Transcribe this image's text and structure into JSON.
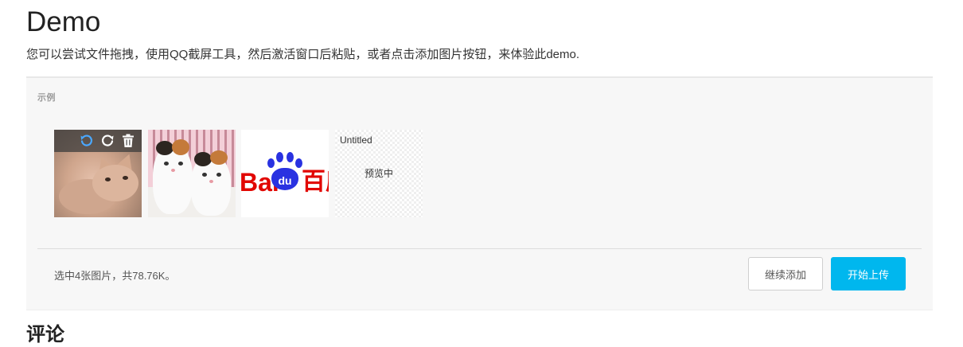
{
  "header": {
    "title": "Demo",
    "description": "您可以尝试文件拖拽，使用QQ截屏工具，然后激活窗口后粘贴，或者点击添加图片按钮，来体验此demo."
  },
  "panel": {
    "label": "示例",
    "thumbnails": [
      {
        "kind": "image",
        "subject": "kitten",
        "overlay_icons": [
          "rotate-left-icon",
          "rotate-right-icon",
          "trash-icon"
        ]
      },
      {
        "kind": "image",
        "subject": "two-kittens"
      },
      {
        "kind": "image",
        "subject": "baidu-logo",
        "logo_text_left": "Bai",
        "logo_text_paw": "du",
        "logo_text_right": "百度"
      },
      {
        "kind": "placeholder",
        "name": "Untitled",
        "status": "预览中"
      }
    ],
    "status_text": "选中4张图片，共78.76K。",
    "buttons": {
      "continue_label": "继续添加",
      "upload_label": "开始上传"
    }
  },
  "next_section": {
    "title": "评论"
  },
  "colors": {
    "accent": "#00b7ee",
    "panel_bg": "#f7f7f7",
    "baidu_red": "#e10601",
    "baidu_blue": "#2932e1"
  }
}
